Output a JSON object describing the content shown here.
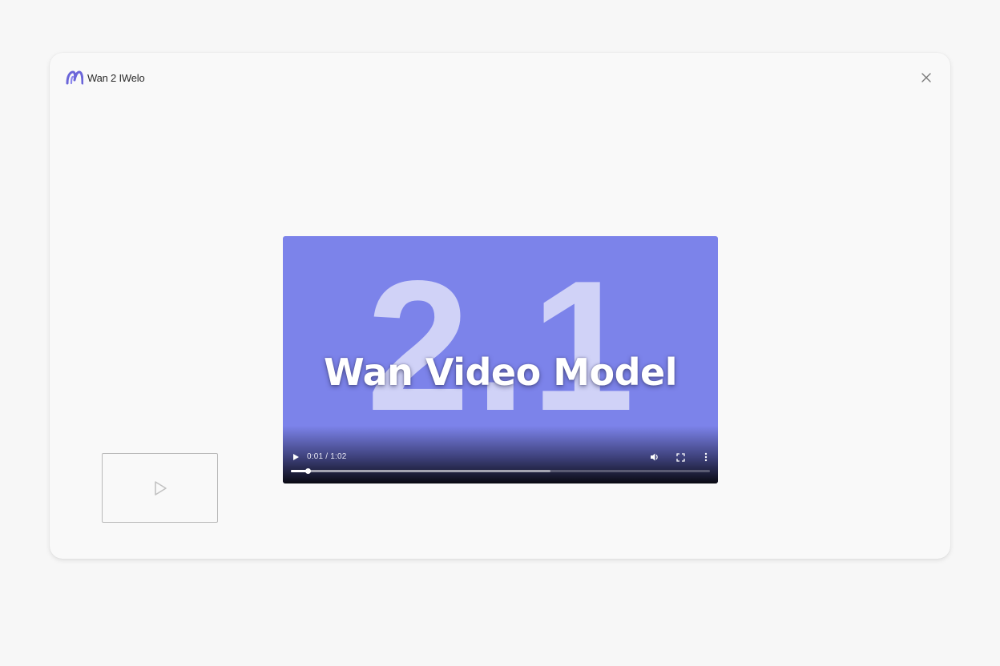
{
  "window": {
    "brand_name": "Wan 2 IWelo",
    "brand_color": "#6b66d9",
    "logo_icon": "wan-logo-icon",
    "close_icon": "close-icon"
  },
  "player": {
    "background_color": "#7c83ea",
    "big_number": "2.1",
    "title": "Wan Video Model",
    "time_display": "0:01 / 1:02",
    "progress_played_fraction": 0.04,
    "progress_buffered_fraction": 0.62,
    "controls": {
      "play_icon": "play-icon",
      "volume_icon": "volume-icon",
      "fullscreen_icon": "fullscreen-icon",
      "more_icon": "more-vertical-icon"
    }
  },
  "thumbnail": {
    "icon": "play-outline-icon"
  }
}
